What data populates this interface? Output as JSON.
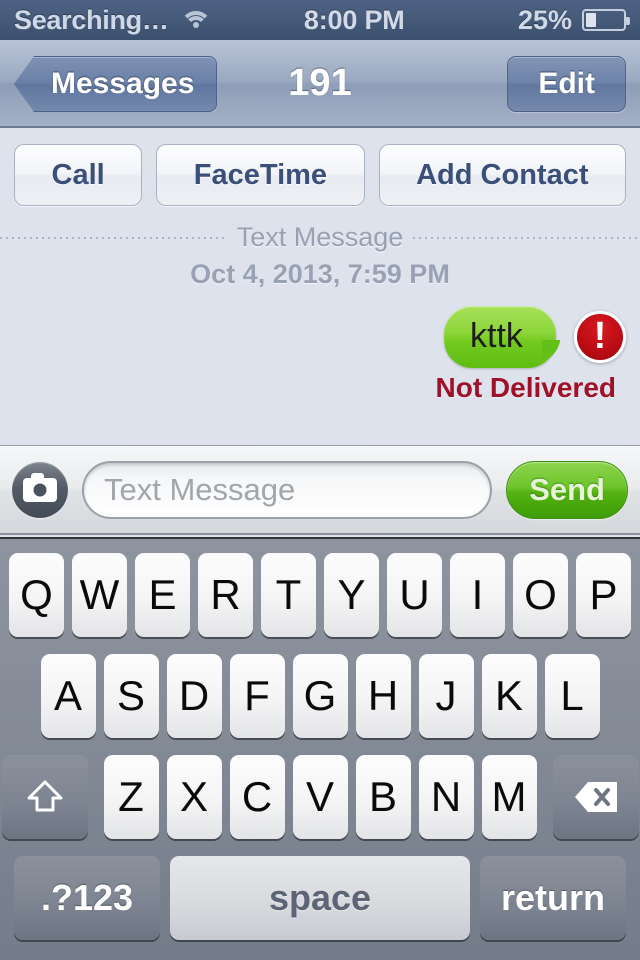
{
  "status_bar": {
    "carrier": "Searching…",
    "wifi_icon": "wifi-icon",
    "time": "8:00 PM",
    "battery_percent": "25%",
    "battery_level": 25
  },
  "nav_bar": {
    "back_label": "Messages",
    "title": "191",
    "edit_label": "Edit"
  },
  "actions": [
    {
      "label": "Call",
      "name": "call-button"
    },
    {
      "label": "FaceTime",
      "name": "facetime-button"
    },
    {
      "label": "Add Contact",
      "name": "add-contact-button"
    }
  ],
  "conversation": {
    "divider_label": "Text Message",
    "timestamp": "Oct 4, 2013, 7:59 PM",
    "message": {
      "text": "kttk",
      "direction": "outgoing",
      "bubble_color": "#73c91f",
      "status": "Not Delivered",
      "status_color": "#9f1029",
      "error_icon": "exclamation-circle-icon"
    }
  },
  "input_toolbar": {
    "camera_icon": "camera-icon",
    "placeholder": "Text Message",
    "value": "",
    "send_label": "Send",
    "send_color": "#53b211"
  },
  "keyboard": {
    "row1": [
      "Q",
      "W",
      "E",
      "R",
      "T",
      "Y",
      "U",
      "I",
      "O",
      "P"
    ],
    "row2": [
      "A",
      "S",
      "D",
      "F",
      "G",
      "H",
      "J",
      "K",
      "L"
    ],
    "row3": [
      "Z",
      "X",
      "C",
      "V",
      "B",
      "N",
      "M"
    ],
    "shift_icon": "shift-arrow-icon",
    "backspace_icon": "backspace-icon",
    "numeric_label": ".?123",
    "space_label": "space",
    "return_label": "return"
  }
}
